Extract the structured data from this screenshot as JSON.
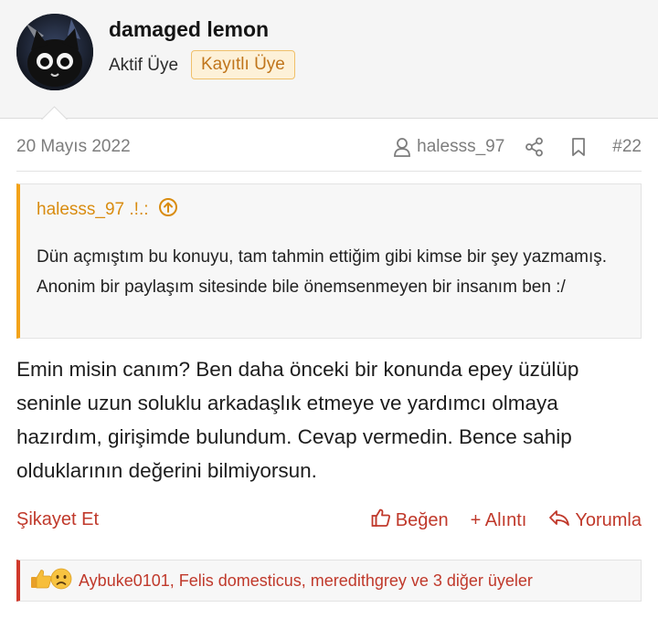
{
  "user": {
    "name": "damaged lemon",
    "title": "Aktif Üye",
    "banner": "Kayıtlı Üye"
  },
  "post": {
    "date": "20 Mayıs 2022",
    "author": "halesss_97",
    "number": "#22"
  },
  "quote": {
    "author": "halesss_97 .!.:",
    "text": "Dün açmıştım bu konuyu, tam tahmin ettiğim gibi kimse bir şey yazmamış. Anonim bir paylaşım sitesinde bile önemsenmeyen bir insanım ben :/"
  },
  "message": "Emin misin canım? Ben daha önceki bir konunda epey üzülüp seninle uzun soluklu arkadaşlık etmeye ve yardımcı olmaya hazırdım, girişimde bulundum. Cevap vermedin. Bence sahip olduklarının değerini bilmiyorsun.",
  "actions": {
    "report": "Şikayet Et",
    "like": "Beğen",
    "quote": "+ Alıntı",
    "reply": "Yorumla"
  },
  "reactions": {
    "text": "Aybuke0101, Felis domesticus, meredithgrey ve 3 diğer üyeler",
    "icons": [
      "thumbs-up-icon",
      "sad-face-icon"
    ]
  },
  "colors": {
    "accent": "#c0392b",
    "quote_accent": "#f3a31a",
    "banner_bg": "#fdf1d8",
    "banner_text": "#c0751b"
  }
}
